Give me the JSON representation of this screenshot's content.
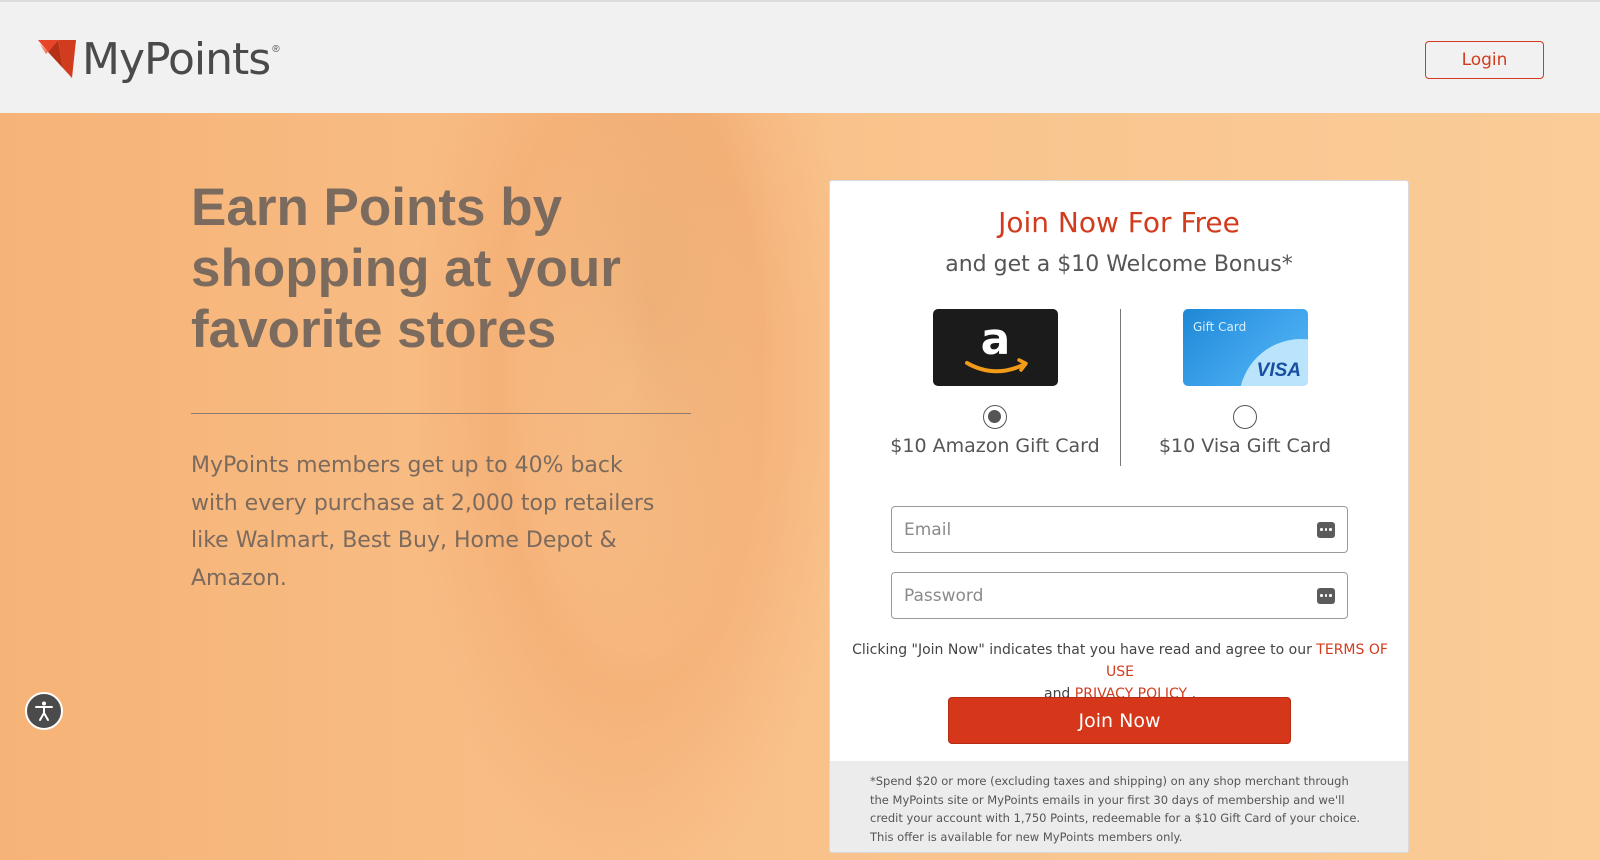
{
  "header": {
    "logo_text": "MyPoints",
    "logo_reg": "®",
    "login_label": "Login"
  },
  "hero": {
    "headline": "Earn Points by shopping at your favorite stores",
    "subtext": "MyPoints members get up to 40% back with every purchase at 2,000 top retailers like Walmart, Best Buy, Home Depot & Amazon."
  },
  "signup": {
    "title": "Join Now For Free",
    "subtitle": "and get a $10 Welcome Bonus*",
    "options": [
      {
        "label": "$10 Amazon Gift Card",
        "selected": true
      },
      {
        "label": "$10 Visa Gift Card",
        "selected": false,
        "card_caption": "Gift Card",
        "card_brand": "VISA"
      }
    ],
    "amazon_card_letter": "a",
    "email_placeholder": "Email",
    "password_placeholder": "Password",
    "consent_prefix": "Clicking \"Join Now\" indicates that you have read and agree to our",
    "terms_link": "TERMS OF USE",
    "consent_and": "and",
    "privacy_link": "PRIVACY POLICY",
    "consent_suffix": ".",
    "join_label": "Join Now",
    "fineprint": "*Spend $20 or more (excluding taxes and shipping) on any shop merchant through the MyPoints site or MyPoints emails in your first 30 days of membership and we'll credit your account with 1,750 Points, redeemable for a $10 Gift Card of your choice. This offer is available for new MyPoints members only."
  },
  "colors": {
    "brand_red": "#d13c1e",
    "hero_orange": "#f9c38a",
    "header_bg": "#f1f1f1"
  },
  "icons": {
    "logo": "mypoints-logo-icon",
    "accessibility": "accessibility-icon",
    "field_autofill": "password-manager-icon"
  }
}
